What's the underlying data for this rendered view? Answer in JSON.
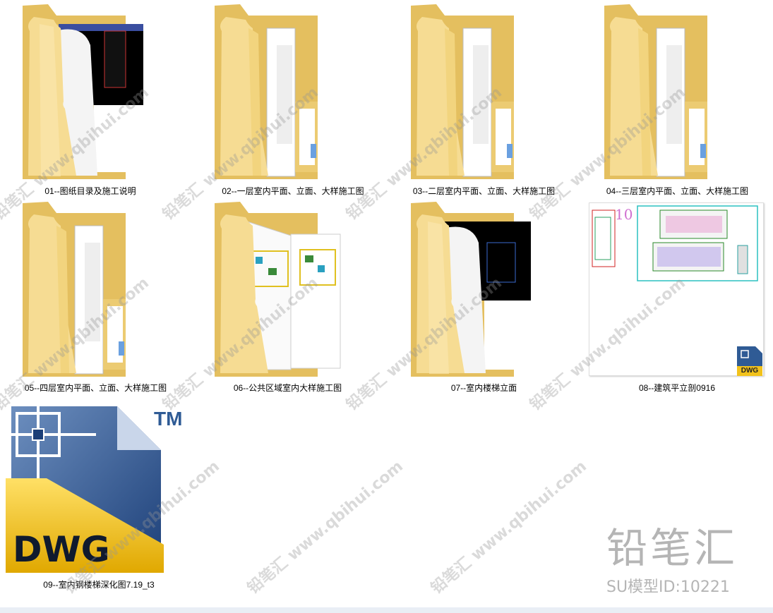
{
  "files": [
    {
      "label": "01--图纸目录及施工说明",
      "kind": "folder-black"
    },
    {
      "label": "02--一层室内平面、立面、大样施工图",
      "kind": "folder-docs"
    },
    {
      "label": "03--二层室内平面、立面、大样施工图",
      "kind": "folder-docs"
    },
    {
      "label": "04--三层室内平面、立面、大样施工图",
      "kind": "folder-docs"
    },
    {
      "label": "05--四层室内平面、立面、大样施工图",
      "kind": "folder-docs"
    },
    {
      "label": "06--公共区域室内大样施工图",
      "kind": "folder-plans"
    },
    {
      "label": "07--室内楼梯立面",
      "kind": "folder-black"
    },
    {
      "label": "08--建筑平立剖0916",
      "kind": "dwg-thumb"
    },
    {
      "label": "09--室内钢楼梯深化图7.19_t3",
      "kind": "dwg-big"
    }
  ],
  "dwg_badge": "DWG",
  "dwg_tm": "TM",
  "thumb_number": "10",
  "watermark": {
    "repeat_text": "铅笔汇 www.qbihui.com",
    "brand": "铅笔汇",
    "id_text": "SU模型ID:10221"
  },
  "colors": {
    "folder_back": "#e9c66a",
    "folder_front": "#f8e3a3",
    "dwg_blue": "#2f5b95",
    "dwg_yellow": "#f2c21b"
  }
}
